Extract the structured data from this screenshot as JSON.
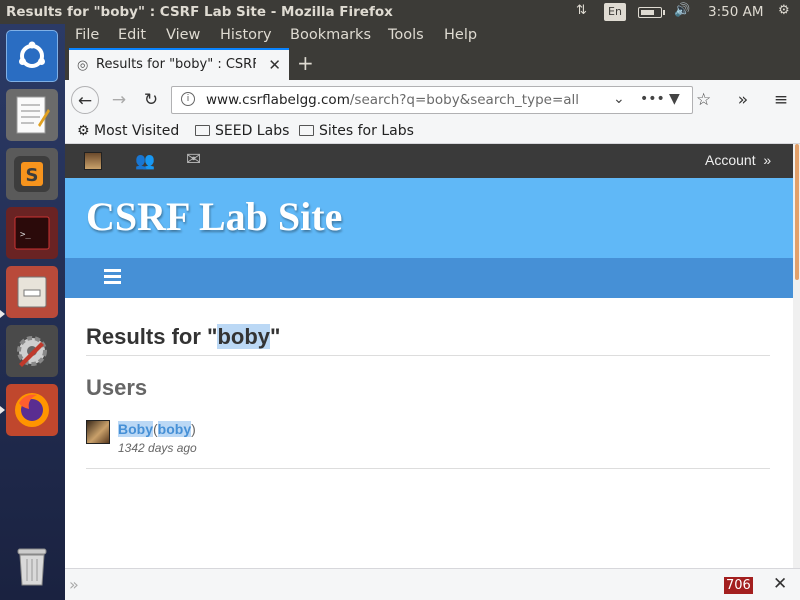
{
  "panel": {
    "window_title": "Results for \"boby\" : CSRF Lab Site - Mozilla Firefox",
    "keyboard_layout": "En",
    "battery_fraction": 0.7,
    "clock": "3:50 AM"
  },
  "launcher": {
    "items": [
      "ubuntu-dash-icon",
      "text-editor-icon",
      "sublime-text-icon",
      "terminal-icon",
      "file-manager-icon",
      "system-settings-icon",
      "firefox-icon",
      "trash-icon"
    ]
  },
  "menubar": {
    "items": [
      "File",
      "Edit",
      "View",
      "History",
      "Bookmarks",
      "Tools",
      "Help"
    ]
  },
  "tabs": [
    {
      "label": "Results for \"boby\" : CSRF",
      "active": true
    }
  ],
  "navbar": {
    "url_host": "www.csrflabelgg.com",
    "url_path": "/search?q=boby&search_type=all"
  },
  "bookmarks": {
    "items": [
      "Most Visited",
      "SEED Labs",
      "Sites for Labs"
    ]
  },
  "site": {
    "account_label": "Account",
    "account_chevron": "»",
    "site_title": "CSRF Lab Site",
    "results_prefix": "Results for \"",
    "results_query": "boby",
    "results_suffix": "\"",
    "users_heading": "Users",
    "user": {
      "name": "Boby",
      "username": "boby",
      "open_paren": "(",
      "close_paren": ")",
      "time_ago": "1342 days ago"
    }
  },
  "findbar": {
    "chevron": "»",
    "match_count": "706"
  },
  "colors": {
    "header_blue": "#60b8f7",
    "subnav_blue": "#4690d6",
    "topbar_dark": "#3a3a3a",
    "link_blue": "#4690d6",
    "highlight": "#bbd8f5"
  }
}
